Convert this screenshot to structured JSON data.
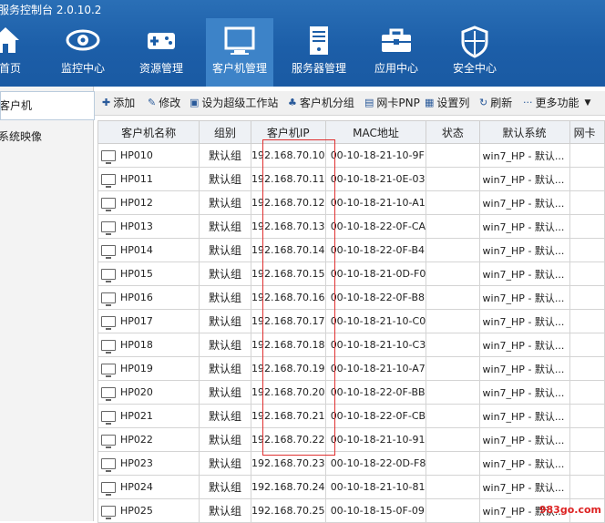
{
  "app": {
    "title": "服务控制台 2.0.10.2"
  },
  "nav": [
    {
      "label": "首页",
      "icon": "home-icon"
    },
    {
      "label": "监控中心",
      "icon": "eye-icon"
    },
    {
      "label": "资源管理",
      "icon": "gamepad-icon"
    },
    {
      "label": "客户机管理",
      "icon": "monitor-icon",
      "active": true
    },
    {
      "label": "服务器管理",
      "icon": "server-icon"
    },
    {
      "label": "应用中心",
      "icon": "toolbox-icon"
    },
    {
      "label": "安全中心",
      "icon": "shield-icon"
    }
  ],
  "sidebar": {
    "items": [
      {
        "label": "客户机",
        "selected": true
      },
      {
        "label": "系统映像"
      }
    ]
  },
  "toolbar": {
    "add": "添加",
    "edit": "修改",
    "super_ws": "设为超级工作站",
    "group": "客户机分组",
    "pnp": "网卡PNP",
    "set_cols": "设置列",
    "refresh": "刷新",
    "more": "更多功能"
  },
  "table": {
    "columns": [
      "客户机名称",
      "组别",
      "客户机IP",
      "MAC地址",
      "状态",
      "默认系统",
      "网卡"
    ],
    "rows": [
      {
        "name": "HP010",
        "group": "默认组",
        "ip": "192.168.70.10",
        "mac": "00-10-18-21-10-9F",
        "status": "",
        "os": "win7_HP - 默认..."
      },
      {
        "name": "HP011",
        "group": "默认组",
        "ip": "192.168.70.11",
        "mac": "00-10-18-21-0E-03",
        "status": "",
        "os": "win7_HP - 默认..."
      },
      {
        "name": "HP012",
        "group": "默认组",
        "ip": "192.168.70.12",
        "mac": "00-10-18-21-10-A1",
        "status": "",
        "os": "win7_HP - 默认..."
      },
      {
        "name": "HP013",
        "group": "默认组",
        "ip": "192.168.70.13",
        "mac": "00-10-18-22-0F-CA",
        "status": "",
        "os": "win7_HP - 默认..."
      },
      {
        "name": "HP014",
        "group": "默认组",
        "ip": "192.168.70.14",
        "mac": "00-10-18-22-0F-B4",
        "status": "",
        "os": "win7_HP - 默认..."
      },
      {
        "name": "HP015",
        "group": "默认组",
        "ip": "192.168.70.15",
        "mac": "00-10-18-21-0D-F0",
        "status": "",
        "os": "win7_HP - 默认..."
      },
      {
        "name": "HP016",
        "group": "默认组",
        "ip": "192.168.70.16",
        "mac": "00-10-18-22-0F-B8",
        "status": "",
        "os": "win7_HP - 默认..."
      },
      {
        "name": "HP017",
        "group": "默认组",
        "ip": "192.168.70.17",
        "mac": "00-10-18-21-10-C0",
        "status": "",
        "os": "win7_HP - 默认..."
      },
      {
        "name": "HP018",
        "group": "默认组",
        "ip": "192.168.70.18",
        "mac": "00-10-18-21-10-C3",
        "status": "",
        "os": "win7_HP - 默认..."
      },
      {
        "name": "HP019",
        "group": "默认组",
        "ip": "192.168.70.19",
        "mac": "00-10-18-21-10-A7",
        "status": "",
        "os": "win7_HP - 默认..."
      },
      {
        "name": "HP020",
        "group": "默认组",
        "ip": "192.168.70.20",
        "mac": "00-10-18-22-0F-BB",
        "status": "",
        "os": "win7_HP - 默认..."
      },
      {
        "name": "HP021",
        "group": "默认组",
        "ip": "192.168.70.21",
        "mac": "00-10-18-22-0F-CB",
        "status": "",
        "os": "win7_HP - 默认..."
      },
      {
        "name": "HP022",
        "group": "默认组",
        "ip": "192.168.70.22",
        "mac": "00-10-18-21-10-91",
        "status": "",
        "os": "win7_HP - 默认..."
      },
      {
        "name": "HP023",
        "group": "默认组",
        "ip": "192.168.70.23",
        "mac": "00-10-18-22-0D-F8",
        "status": "",
        "os": "win7_HP - 默认..."
      },
      {
        "name": "HP024",
        "group": "默认组",
        "ip": "192.168.70.24",
        "mac": "00-10-18-21-10-81",
        "status": "",
        "os": "win7_HP - 默认..."
      },
      {
        "name": "HP025",
        "group": "默认组",
        "ip": "192.168.70.25",
        "mac": "00-10-18-15-0F-09",
        "status": "",
        "os": "win7_HP - 默认..."
      }
    ]
  },
  "watermark": "983go.com",
  "colors": {
    "header_blue": "#1c5ea8",
    "active_tab": "#3d83c8",
    "highlight_box": "#e03030"
  }
}
